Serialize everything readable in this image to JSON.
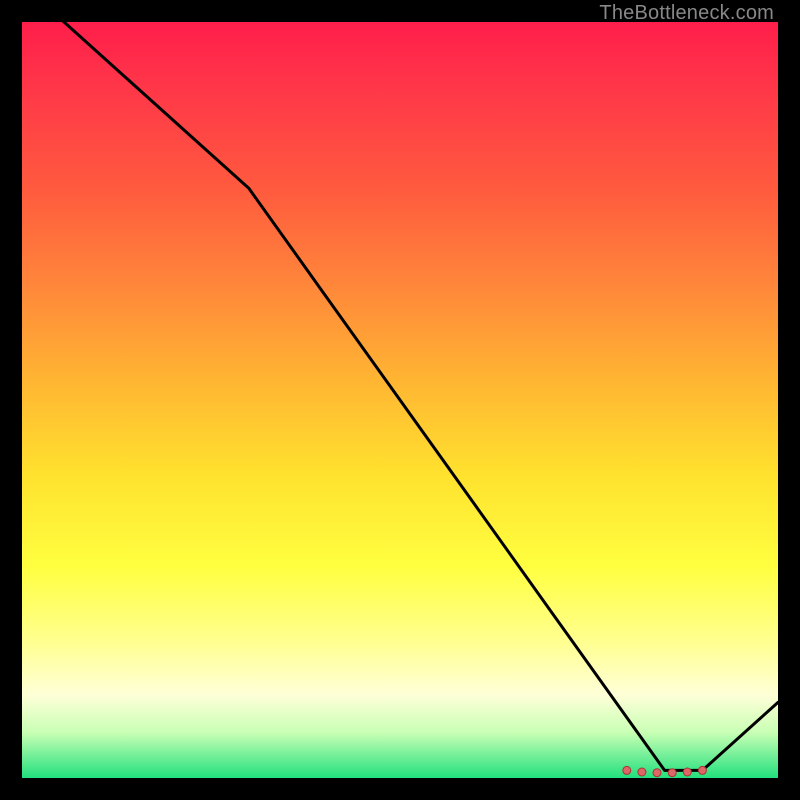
{
  "watermark": "TheBottleneck.com",
  "chart_data": {
    "type": "line",
    "title": "",
    "xlabel": "",
    "ylabel": "",
    "xlim": [
      0,
      100
    ],
    "ylim": [
      0,
      100
    ],
    "x": [
      0,
      10,
      20,
      30,
      40,
      50,
      60,
      70,
      80,
      85,
      90,
      100
    ],
    "values": [
      105,
      96,
      87,
      78,
      64,
      50,
      36,
      22,
      8,
      1,
      1,
      10
    ],
    "markers": {
      "x": [
        80,
        82,
        84,
        86,
        88,
        90
      ],
      "values": [
        1.0,
        0.8,
        0.7,
        0.7,
        0.8,
        1.0
      ]
    },
    "background_gradient": {
      "top": "#ff1e4b",
      "mid": "#ffe22e",
      "bottom": "#22e07e"
    }
  }
}
